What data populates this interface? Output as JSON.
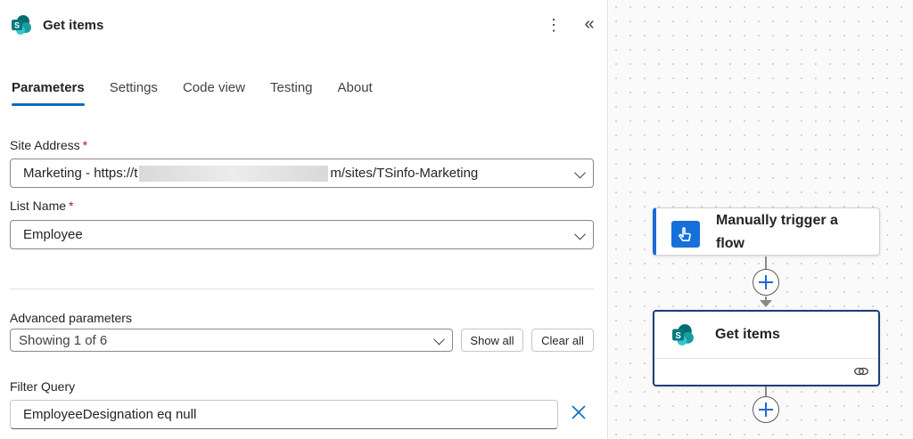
{
  "header": {
    "title": "Get items",
    "more_icon": "more-vertical-icon",
    "collapse_icon": "double-chevron-left-icon"
  },
  "tabs": [
    {
      "label": "Parameters",
      "active": true
    },
    {
      "label": "Settings"
    },
    {
      "label": "Code view"
    },
    {
      "label": "Testing"
    },
    {
      "label": "About"
    }
  ],
  "site_address": {
    "label": "Site Address",
    "required_mark": "*",
    "value_prefix": "Marketing - https://t",
    "value_suffix": "m/sites/TSinfo-Marketing"
  },
  "list_name": {
    "label": "List Name",
    "required_mark": "*",
    "value": "Employee"
  },
  "advanced": {
    "label": "Advanced parameters",
    "value": "Showing 1 of 6",
    "show_all": "Show all",
    "clear_all": "Clear all"
  },
  "filter_query": {
    "label": "Filter Query",
    "value": "EmployeeDesignation eq null"
  },
  "canvas": {
    "trigger_card": {
      "title_line1": "Manually trigger a",
      "title_line2": "flow"
    },
    "action_card": {
      "title": "Get items"
    }
  },
  "colors": {
    "accent": "#0f6cbd",
    "sharepoint_teal": "#038387",
    "trigger_blue": "#1570d9",
    "required": "#c50f1f"
  }
}
